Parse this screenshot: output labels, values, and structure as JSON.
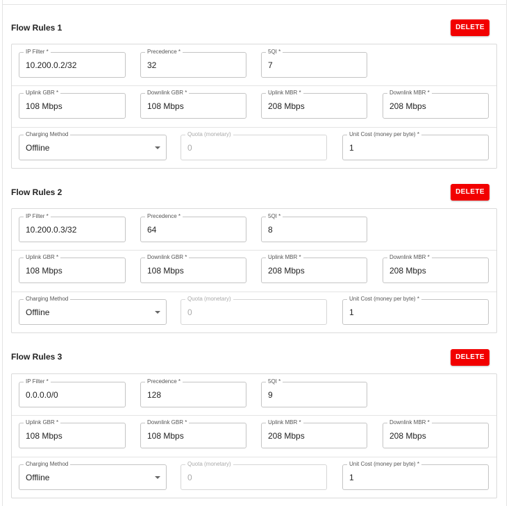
{
  "delete_label": "DELETE",
  "labels": {
    "ip_filter": "IP Filter *",
    "precedence": "Precedence *",
    "fiveqi": "5QI *",
    "uplink_gbr": "Uplink GBR *",
    "downlink_gbr": "Downlink GBR *",
    "uplink_mbr": "Uplink MBR *",
    "downlink_mbr": "Downlink MBR *",
    "charging_method": "Charging Method",
    "quota": "Quota (monetary)",
    "unit_cost": "Unit Cost (money per byte) *"
  },
  "rules": [
    {
      "title": "Flow Rules 1",
      "ip_filter": "10.200.0.2/32",
      "precedence": "32",
      "fiveqi": "7",
      "uplink_gbr": "108 Mbps",
      "downlink_gbr": "108 Mbps",
      "uplink_mbr": "208 Mbps",
      "downlink_mbr": "208 Mbps",
      "charging_method": "Offline",
      "quota": "0",
      "unit_cost": "1"
    },
    {
      "title": "Flow Rules 2",
      "ip_filter": "10.200.0.3/32",
      "precedence": "64",
      "fiveqi": "8",
      "uplink_gbr": "108 Mbps",
      "downlink_gbr": "108 Mbps",
      "uplink_mbr": "208 Mbps",
      "downlink_mbr": "208 Mbps",
      "charging_method": "Offline",
      "quota": "0",
      "unit_cost": "1"
    },
    {
      "title": "Flow Rules 3",
      "ip_filter": "0.0.0.0/0",
      "precedence": "128",
      "fiveqi": "9",
      "uplink_gbr": "108 Mbps",
      "downlink_gbr": "108 Mbps",
      "uplink_mbr": "208 Mbps",
      "downlink_mbr": "208 Mbps",
      "charging_method": "Offline",
      "quota": "0",
      "unit_cost": "1"
    }
  ]
}
